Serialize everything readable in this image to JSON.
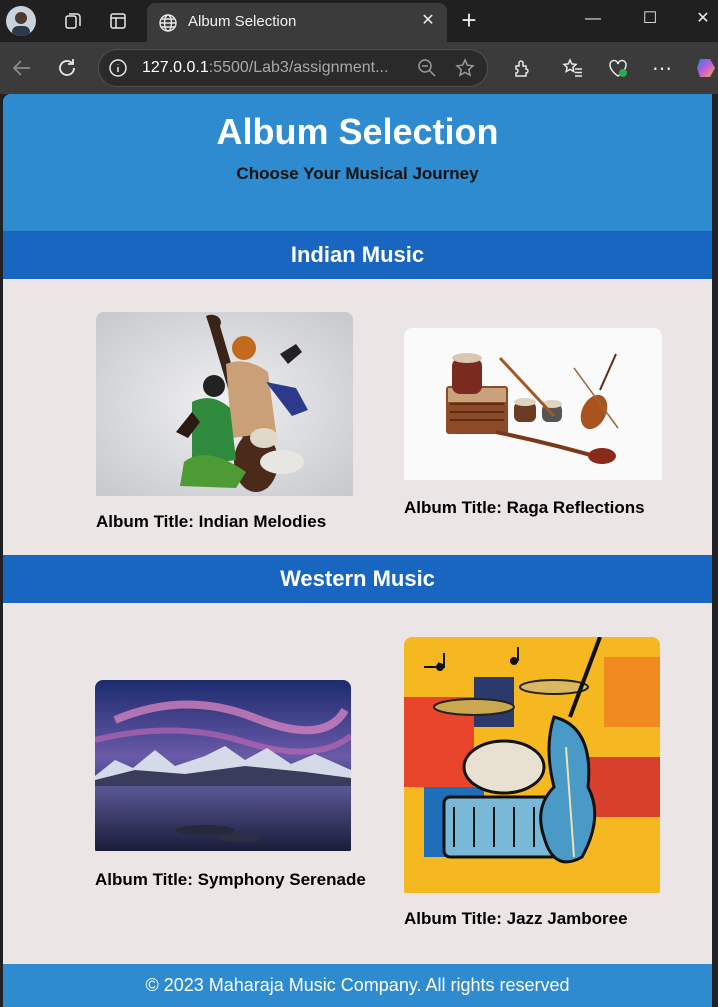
{
  "browser": {
    "tab_title": "Album Selection",
    "url_host": "127.0.0.1",
    "url_rest": ":5500/Lab3/assignment..."
  },
  "page": {
    "title": "Album Selection",
    "subtitle": "Choose Your Musical Journey",
    "footer": "© 2023 Maharaja Music Company. All rights reserved"
  },
  "sections": [
    {
      "heading": "Indian Music",
      "albums": [
        {
          "caption": "Album Title: Indian Melodies",
          "image": "indian-musicians-sculpture"
        },
        {
          "caption": "Album Title: Raga Reflections",
          "image": "indian-instruments"
        }
      ]
    },
    {
      "heading": "Western Music",
      "albums": [
        {
          "caption": "Album Title: Symphony Serenade",
          "image": "mountain-lake-dusk"
        },
        {
          "caption": "Album Title: Jazz Jamboree",
          "image": "cubist-jazz-instruments"
        }
      ]
    }
  ],
  "colors": {
    "header_bg": "#2e8bd0",
    "section_bar_bg": "#1866c0",
    "page_bg": "#ebe5e5"
  }
}
